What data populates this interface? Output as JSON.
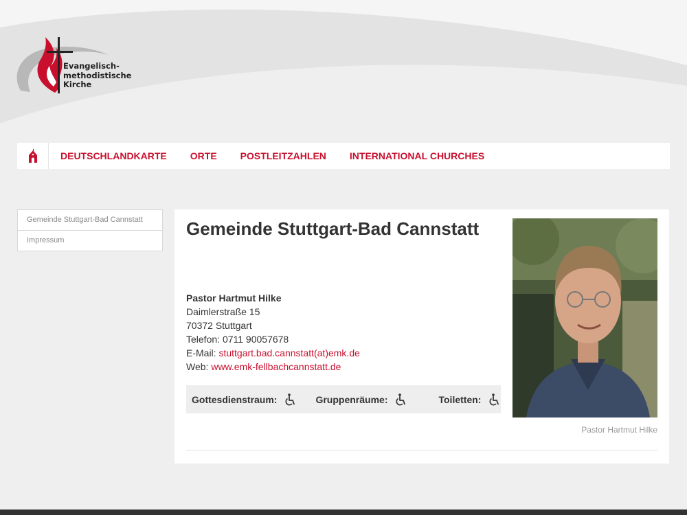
{
  "logo": {
    "alt": "Evangelisch-methodistische Kirche logo",
    "lines": [
      "Evangelisch-",
      "methodistische",
      "Kirche"
    ]
  },
  "nav": {
    "home_icon": "church-icon",
    "items": [
      "DEUTSCHLANDKARTE",
      "ORTE",
      "POSTLEITZAHLEN",
      "INTERNATIONAL CHURCHES"
    ]
  },
  "sidebar": {
    "items": [
      "Gemeinde Stuttgart-Bad Cannstatt",
      "Impressum"
    ]
  },
  "main": {
    "title": "Gemeinde Stuttgart-Bad Cannstatt",
    "pastor": "Pastor Hartmut Hilke",
    "street": "Daimlerstraße 15",
    "city": "70372 Stuttgart",
    "phone_label": "Telefon:",
    "phone": "0711 90057678",
    "email_label": "E-Mail:",
    "email": "stuttgart.bad.cannstatt(at)emk.de",
    "web_label": "Web:",
    "web": "www.emk-fellbachcannstatt.de",
    "accessibility": [
      {
        "label": "Gottesdienstraum:",
        "icon": "wheelchair-icon"
      },
      {
        "label": "Gruppenräume:",
        "icon": "wheelchair-icon"
      },
      {
        "label": "Toiletten:",
        "icon": "wheelchair-icon"
      }
    ],
    "photo_alt": "Pastor Hartmut Hilke",
    "photo_caption": "Pastor Hartmut Hilke"
  },
  "colors": {
    "accent": "#c8102e",
    "background": "#efefef",
    "footer": "#333333"
  }
}
